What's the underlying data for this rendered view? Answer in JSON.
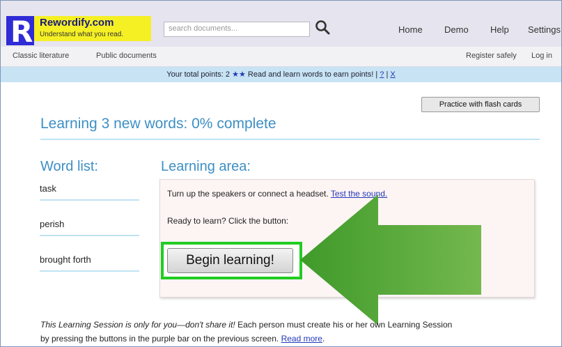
{
  "brand": {
    "name": "Rewordify.com",
    "tagline": "Understand what you read.",
    "logo_letter": "R"
  },
  "search": {
    "placeholder": "search documents..."
  },
  "nav": {
    "home": "Home",
    "demo": "Demo",
    "help": "Help",
    "settings": "Settings"
  },
  "subnav": {
    "classic": "Classic literature",
    "public": "Public documents",
    "register": "Register safely",
    "login": "Log in"
  },
  "points": {
    "prefix": "Your total points: 2",
    "stars": "★★",
    "message": "Read and learn words to earn points!",
    "sep1": "|",
    "help_link": "?",
    "sep2": "|",
    "close_link": "X"
  },
  "flash_button": "Practice with flash cards",
  "progress": {
    "title": "Learning 3 new words: 0% complete",
    "percent": 0
  },
  "word_list": {
    "heading": "Word list:",
    "words": [
      "task",
      "perish",
      "brought forth"
    ]
  },
  "learning_area": {
    "heading": "Learning area:",
    "sound_text": "Turn up the speakers or connect a headset.",
    "sound_link": "Test the sound.",
    "ready_text": "Ready to learn? Click the button:",
    "begin_button": "Begin learning!"
  },
  "footer": {
    "line1_italic": "This Learning Session is only for you—don't share it!",
    "line1_rest": "Each person must create his or her own Learning Session",
    "line2": "by pressing the buttons in the purple bar on the previous screen.",
    "read_more": "Read more"
  },
  "colors": {
    "accent_blue": "#3d8fc4",
    "highlight_green": "#22cc22",
    "arrow_green": "#5ea83a",
    "brand_yellow": "#f5f024",
    "logo_blue": "#2f2bd6"
  },
  "icons": {
    "search": "search-icon",
    "arrow": "green-arrow-icon"
  }
}
